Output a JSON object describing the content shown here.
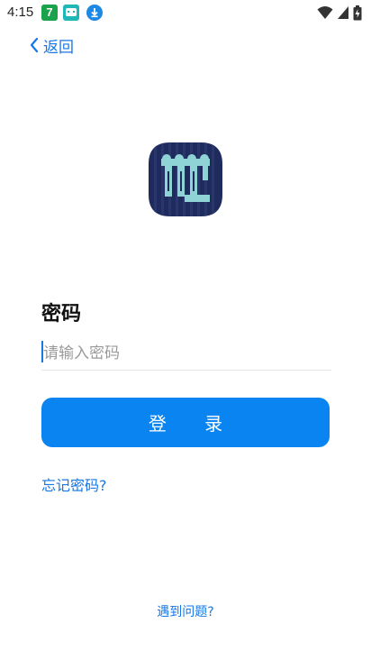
{
  "status_bar": {
    "time": "4:15",
    "notification_icons": [
      "app-7-icon",
      "cat-app-icon",
      "download-icon"
    ],
    "system_icons": [
      "wifi-icon",
      "signal-icon",
      "battery-icon"
    ]
  },
  "nav": {
    "back_label": "返回",
    "back_icon": "chevron-left-icon"
  },
  "logo": {
    "icon": "app-logo-icon"
  },
  "form": {
    "password_label": "密码",
    "password_placeholder": "请输入密码",
    "password_value": ""
  },
  "actions": {
    "login_label": "登 录",
    "forgot_label": "忘记密码?",
    "problem_label": "遇到问题?"
  },
  "colors": {
    "accent": "#1677e6",
    "button": "#0a84f0",
    "logo_bg": "#1e2b5c",
    "logo_fg": "#8fd3d6"
  }
}
